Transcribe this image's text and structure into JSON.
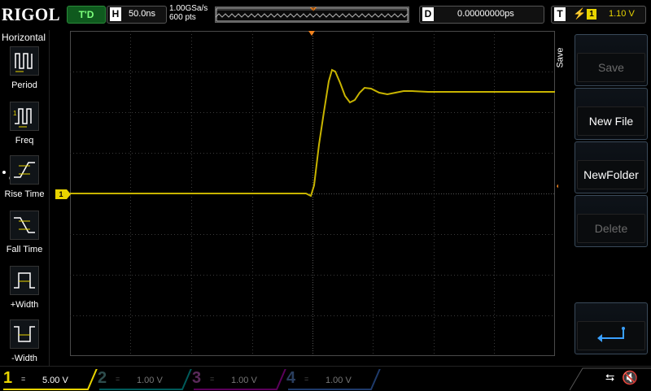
{
  "header": {
    "logo": "RIGOL",
    "run_status": "T'D",
    "timebase_label": "H",
    "timebase_value": "50.0ns",
    "sample_rate": "1.00GSa/s",
    "memory_depth": "600 pts",
    "delay_label": "D",
    "delay_value": "0.00000000ps",
    "trigger_label": "T",
    "trigger_source": "1",
    "trigger_level": "1.10 V"
  },
  "left_menu": {
    "title": "Horizontal",
    "items": [
      {
        "label": "Period",
        "icon": "period-icon"
      },
      {
        "label": "Freq",
        "icon": "frequency-icon"
      },
      {
        "label": "Rise Time",
        "icon": "rise-time-icon",
        "selected": true
      },
      {
        "label": "Fall Time",
        "icon": "fall-time-icon"
      },
      {
        "label": "+Width",
        "icon": "positive-width-icon"
      },
      {
        "label": "-Width",
        "icon": "negative-width-icon"
      }
    ]
  },
  "right_menu": {
    "title": "Save",
    "buttons": [
      {
        "label": "Save",
        "enabled": false
      },
      {
        "label": "New File",
        "enabled": true
      },
      {
        "label": "NewFolder",
        "enabled": true
      },
      {
        "label": "Delete",
        "enabled": false
      }
    ],
    "back_icon": "return-arrow-icon"
  },
  "markers": {
    "ch1_ground": "1",
    "trigger_level": "T"
  },
  "channels": [
    {
      "number": "1",
      "coupling": "DC",
      "scale": "5.00 V",
      "color": "#e8d400",
      "active": true
    },
    {
      "number": "2",
      "coupling": "DC",
      "scale": "1.00 V",
      "color": "#00b4b4",
      "active": false
    },
    {
      "number": "3",
      "coupling": "DC",
      "scale": "1.00 V",
      "color": "#c000c0",
      "active": false
    },
    {
      "number": "4",
      "coupling": "DC",
      "scale": "1.00 V",
      "color": "#3a7acc",
      "active": false
    }
  ],
  "status_icons": [
    "usb-icon",
    "mute-icon"
  ],
  "colors": {
    "ch1": "#e8d400",
    "trigger": "#f0821e",
    "grid": "#3a3a3a",
    "run_status_bg": "#0f5a1e"
  }
}
